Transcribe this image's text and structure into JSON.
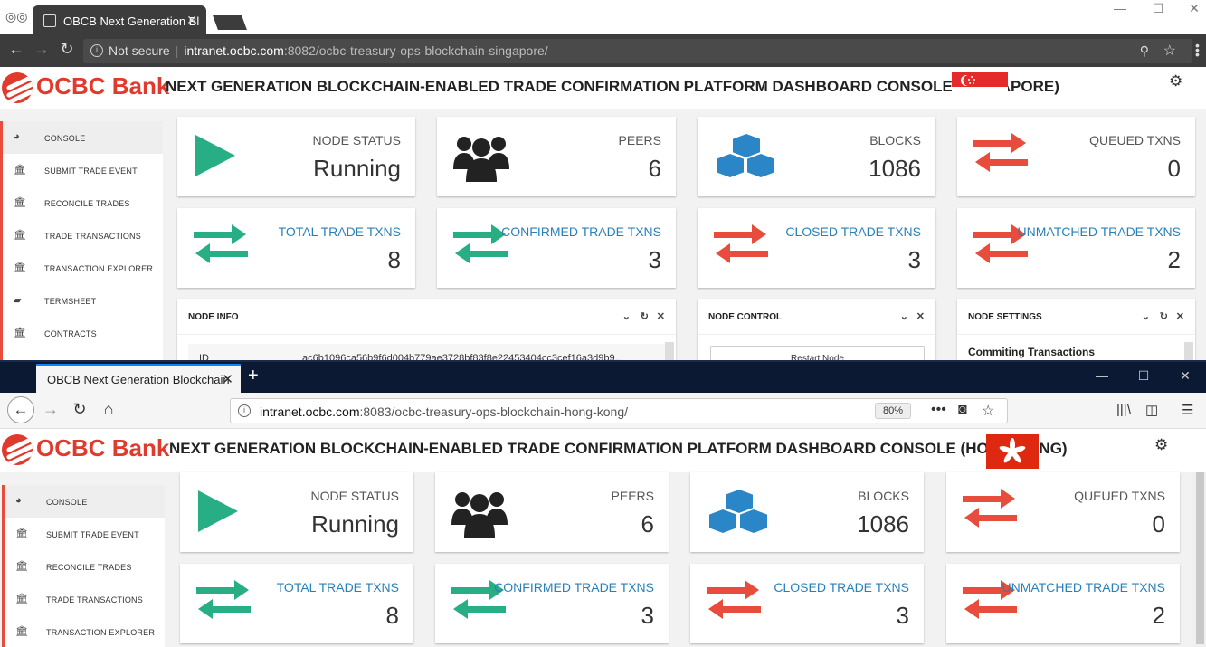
{
  "chrome": {
    "tab_title": "OBCB Next Generation Bl",
    "security": "Not secure",
    "url_host": "intranet.ocbc.com",
    "url_rest": ":8082/ocbc-treasury-ops-blockchain-singapore/"
  },
  "firefox": {
    "tab_title": "OBCB Next Generation Blockchain",
    "url_host": "intranet.ocbc.com",
    "url_rest": ":8083/ocbc-treasury-ops-blockchain-hong-kong/",
    "zoom": "80%"
  },
  "brand": {
    "name": "OCBC Bank",
    "accent": "#e03a2d"
  },
  "sg": {
    "title": "NEXT GENERATION BLOCKCHAIN-ENABLED TRADE CONFIRMATION PLATFORM DASHBOARD CONSOLE (SINGAPORE)",
    "flag": "singapore-flag"
  },
  "hk": {
    "title": "NEXT GENERATION BLOCKCHAIN-ENABLED TRADE CONFIRMATION PLATFORM DASHBOARD CONSOLE (HONG KONG)",
    "flag": "hong-kong-flag"
  },
  "sidebar": {
    "items": [
      {
        "label": "CONSOLE",
        "icon": "dashboard-icon"
      },
      {
        "label": "SUBMIT TRADE EVENT",
        "icon": "bank-icon"
      },
      {
        "label": "RECONCILE TRADES",
        "icon": "bank-icon"
      },
      {
        "label": "TRADE TRANSACTIONS",
        "icon": "bank-icon"
      },
      {
        "label": "TRANSACTION EXPLORER",
        "icon": "bank-icon"
      },
      {
        "label": "TERMSHEET",
        "icon": "book-icon"
      },
      {
        "label": "CONTRACTS",
        "icon": "bank-icon"
      }
    ]
  },
  "stats": {
    "node_status": {
      "label": "NODE STATUS",
      "value": "Running"
    },
    "peers": {
      "label": "PEERS",
      "value": "6"
    },
    "blocks": {
      "label": "BLOCKS",
      "value": "1086"
    },
    "queued": {
      "label": "QUEUED TXNS",
      "value": "0"
    },
    "total": {
      "label": "TOTAL TRADE TXNS",
      "value": "8"
    },
    "confirmed": {
      "label": "CONFIRMED TRADE TXNS",
      "value": "3"
    },
    "closed": {
      "label": "CLOSED TRADE TXNS",
      "value": "3"
    },
    "unmatched": {
      "label": "UNMATCHED TRADE TXNS",
      "value": "2"
    }
  },
  "panels": {
    "node_info": {
      "title": "NODE INFO",
      "id_label": "ID",
      "id_value": "ac6b1096ca56b9f6d004b779ae3728bf83f8e22453404cc3cef16a3d9b9..."
    },
    "node_control": {
      "title": "NODE CONTROL",
      "restart_label": "Restart Node"
    },
    "node_settings": {
      "title": "NODE SETTINGS",
      "setting_label": "Commiting Transactions"
    }
  },
  "colors": {
    "green": "#27ae84",
    "red": "#e74c3c",
    "blue": "#2a86c6",
    "link_blue": "#2980b9"
  }
}
